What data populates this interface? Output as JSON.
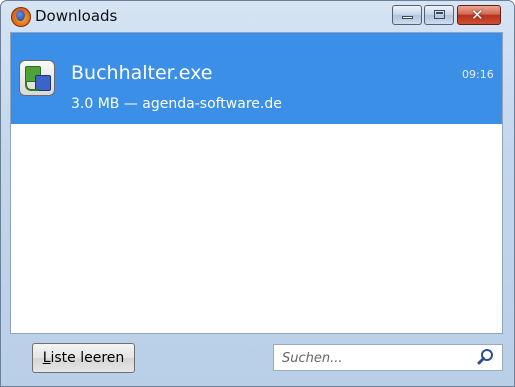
{
  "window": {
    "title": "Downloads"
  },
  "downloads": [
    {
      "filename": "Buchhalter.exe",
      "details": "3.0 MB — agenda-software.de",
      "time": "09:16"
    }
  ],
  "toolbar": {
    "clear_label_accel": "L",
    "clear_label_rest": "iste leeren"
  },
  "search": {
    "placeholder": "Suchen..."
  },
  "icons": {
    "app": "firefox-icon",
    "file": "exe-file-icon",
    "search": "magnifier-icon"
  },
  "colors": {
    "selection": "#3c8fe6",
    "close_button": "#c8452c"
  }
}
